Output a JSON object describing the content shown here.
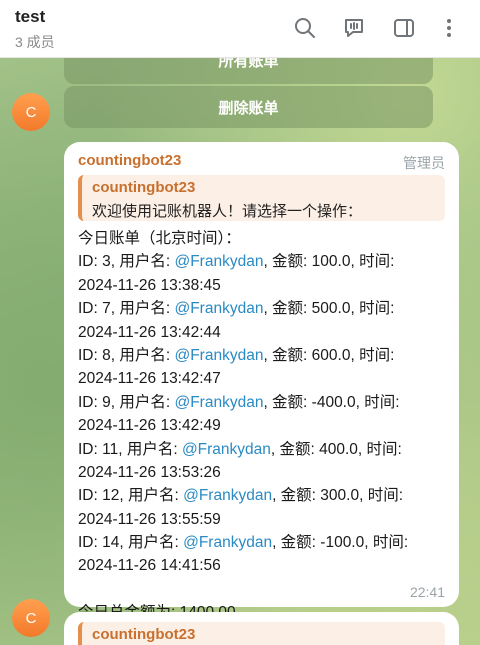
{
  "header": {
    "title": "test",
    "subtitle": "3 成员",
    "icons": [
      "search-icon",
      "voice-chat-icon",
      "side-panel-icon",
      "more-icon"
    ]
  },
  "keyboard": {
    "btn_all": "所有账单",
    "btn_delete": "删除账单"
  },
  "avatar_letter": "C",
  "message": {
    "sender": "countingbot23",
    "role": "管理员",
    "reply": {
      "name": "countingbot23",
      "text": "欢迎使用记账机器人！请选择一个操作："
    },
    "heading": "今日账单（北京时间）：",
    "entries": [
      {
        "prefix": "ID: 3, 用户名: ",
        "user": "@Frankydan",
        "suffix": ", 金额: 100.0, 时间:",
        "time": "2024-11-26 13:38:45"
      },
      {
        "prefix": "ID: 7, 用户名: ",
        "user": "@Frankydan",
        "suffix": ", 金额: 500.0, 时间:",
        "time": "2024-11-26 13:42:44"
      },
      {
        "prefix": "ID: 8, 用户名: ",
        "user": "@Frankydan",
        "suffix": ", 金额: 600.0, 时间:",
        "time": "2024-11-26 13:42:47"
      },
      {
        "prefix": "ID: 9, 用户名: ",
        "user": "@Frankydan",
        "suffix": ", 金额: -400.0, 时间:",
        "time": "2024-11-26 13:42:49"
      },
      {
        "prefix": "ID: 11, 用户名: ",
        "user": "@Frankydan",
        "suffix": ", 金额: 400.0, 时间:",
        "time": "2024-11-26 13:53:26"
      },
      {
        "prefix": "ID: 12, 用户名: ",
        "user": "@Frankydan",
        "suffix": ", 金额: 300.0, 时间:",
        "time": "2024-11-26 13:55:59"
      },
      {
        "prefix": "ID: 14, 用户名: ",
        "user": "@Frankydan",
        "suffix": ", 金额: -100.0, 时间:",
        "time": "2024-11-26 14:41:56"
      }
    ],
    "total": "今日总金额为: 1400.00",
    "time": "22:41"
  },
  "message2": {
    "reply_name": "countingbot23"
  },
  "colors": {
    "accent_orange": "#c8702e",
    "mention_blue": "#2a8ac4",
    "reply_bg": "#fcefe6"
  }
}
